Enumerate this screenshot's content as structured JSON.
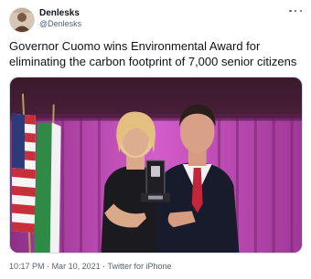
{
  "author": {
    "display_name": "Denlesks",
    "handle": "@Denlesks",
    "avatar_icon": "profile-photo"
  },
  "menu_icon": "more-dots-icon",
  "tweet": {
    "text": "Governor Cuomo wins Environmental Award for eliminating the carbon footprint of 7,000 senior citizens"
  },
  "meta": {
    "time": "10:17 PM",
    "separator": "·",
    "date": "Mar 10, 2021",
    "source": "Twitter for iPhone"
  },
  "colors": {
    "text": "#0f1419",
    "secondary": "#536471",
    "border": "#cfd9de",
    "curtain": "#c04ab8"
  }
}
